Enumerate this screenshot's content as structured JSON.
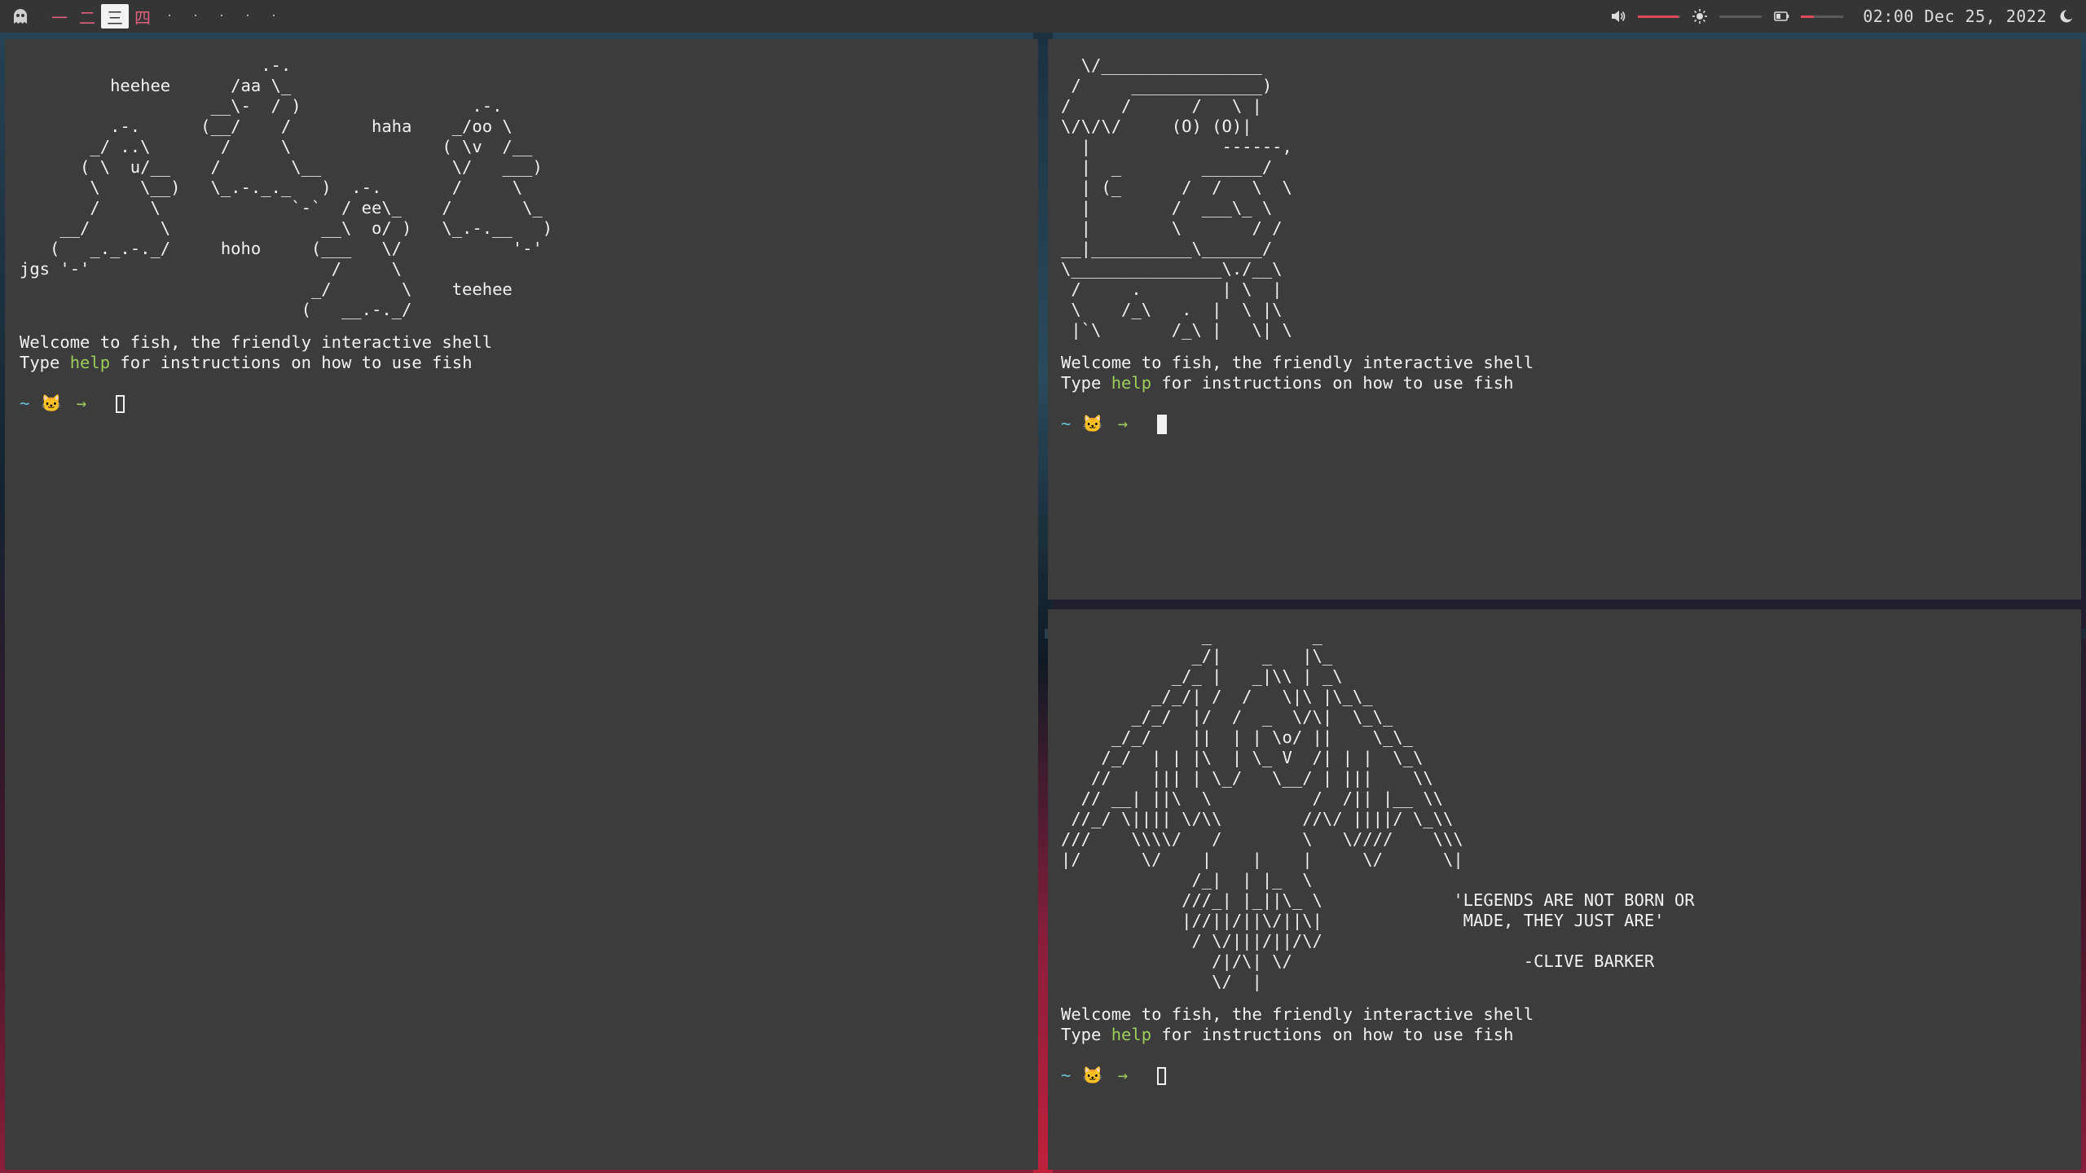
{
  "topbar": {
    "workspaces": [
      "一",
      "二",
      "三",
      "四"
    ],
    "active_workspace": "三",
    "empty_workspaces": [
      "·",
      "·",
      "·",
      "·",
      "·"
    ],
    "volume_level": 0.95,
    "brightness_level": 0.0,
    "battery_level": 0.3,
    "datetime": "02:00 Dec 25, 2022"
  },
  "terminals": [
    {
      "art": "                        .-.\n         heehee      /aa \\_\n                   __\\-  / )                 .-.\n         .-.      (__/    /        haha    _/oo \\\n       _/ ..\\       /     \\               ( \\v  /__\n      ( \\  u/__    /       \\__             \\/   ___)\n       \\    \\__)   \\_.-._._   )  .-.       /     \\\n       /     \\             `-`  / ee\\_    /       \\_\n    __/       \\               __\\  o/ )   \\_.-.__   )\n   (   _._.-._/     hoho     (___   \\/           '-'\njgs '-'                        /     \\\n                             _/       \\    teehee\n                            (   __.-._/",
      "welcome_line1": "Welcome to fish, the friendly interactive shell",
      "welcome_pre": "Type ",
      "welcome_help": "help",
      "welcome_post": " for instructions on how to use fish",
      "prompt_tilde": "~",
      "prompt_cat": "🐱",
      "prompt_arrow": "→"
    },
    {
      "art": "  \\/________________\n /     _____________)\n/     /      /   \\ |\n\\/\\/\\/     (O) (O)|\n  |             ------,\n  |  _        ______/\n  | (_      /  /   \\  \\\n  |        /  ___\\_ \\\n  |        \\       / /\n__|__________\\______/\n\\_______________\\./__\\\n /     .        | \\  |\n \\    /_\\   .  |  \\ |\\\n |`\\       /_\\ |   \\| \\",
      "welcome_line1": "Welcome to fish, the friendly interactive shell",
      "welcome_pre": "Type ",
      "welcome_help": "help",
      "welcome_post": " for instructions on how to use fish",
      "prompt_tilde": "~",
      "prompt_cat": "🐱",
      "prompt_arrow": "→"
    },
    {
      "art": "              _          _\n             _/|    _   |\\_\n           _/_ |   _|\\\\ | _\\\n         _/_/| /  /   \\|\\ |\\_\\_\n       _/_/  |/  /  _  \\/\\|  \\_\\_\n     _/_/    ||  | | \\o/ ||    \\_\\_\n    /_/  | | |\\  | \\_ V  /| | |  \\_\\\n   //    ||| | \\_/   \\__/ | |||    \\\\\n  // __| ||\\  \\          /  /|| |__ \\\\\n //_/ \\|||| \\/\\\\        //\\/ ||||/ \\_\\\\\n///    \\\\\\\\/   /        \\   \\////    \\\\\\\n|/      \\/    |    |    |     \\/      \\|\n             /_|  | |_  \\\n            ///_| |_||\\_ \\             'LEGENDS ARE NOT BORN OR\n            |//||/||\\/||\\|              MADE, THEY JUST ARE'\n             / \\/|||/||/\\/\n               /|/\\| \\/                       -CLIVE BARKER\n               \\/  |",
      "welcome_line1": "Welcome to fish, the friendly interactive shell",
      "welcome_pre": "Type ",
      "welcome_help": "help",
      "welcome_post": " for instructions on how to use fish",
      "prompt_tilde": "~",
      "prompt_cat": "🐱",
      "prompt_arrow": "→"
    }
  ]
}
